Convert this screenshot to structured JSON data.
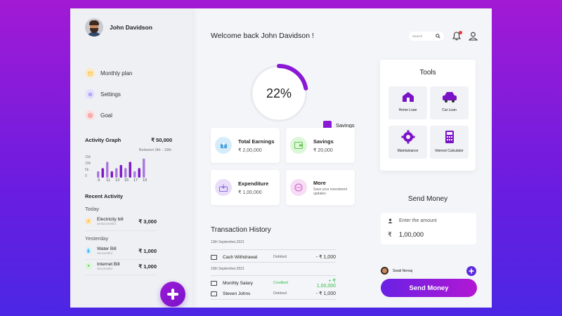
{
  "profile": {
    "name": "John Davidson"
  },
  "menu": [
    {
      "label": "Monthly plan",
      "color": "#f5c542",
      "bg": "#fbe9c7",
      "icon": "calendar-icon"
    },
    {
      "label": "Settings",
      "color": "#8f86e8",
      "bg": "#e3e1fb",
      "icon": "gear-icon"
    },
    {
      "label": "Goal",
      "color": "#ef6f6f",
      "bg": "#fbdfdf",
      "icon": "target-icon"
    }
  ],
  "activity": {
    "title": "Activity Graph",
    "amount": "₹ 50,000",
    "range": "Between  9th - 19th"
  },
  "chart_data": {
    "type": "bar",
    "title": "Activity Graph",
    "categories": [
      "9",
      "10",
      "11",
      "12",
      "13",
      "14",
      "15",
      "16",
      "17",
      "18",
      "19"
    ],
    "values": [
      4,
      6,
      10,
      4,
      6,
      8,
      6,
      10,
      4,
      6,
      12
    ],
    "y_ticks": [
      "15k",
      "10k",
      "5k",
      "0"
    ],
    "x_tick_labels": [
      "9",
      "11",
      "13",
      "15",
      "17",
      "19"
    ],
    "ylim": [
      0,
      15
    ],
    "colors": [
      "#a978dd",
      "#7d12c6"
    ]
  },
  "recent": {
    "title": "Recent Activity",
    "today_label": "Today",
    "yesterday_label": "Yesterday",
    "today": [
      {
        "name": "Electricity bill",
        "status": "Unsuccessful",
        "amount": "₹ 3,000",
        "color": "#f7b267",
        "icon": "bolt-icon"
      }
    ],
    "yesterday": [
      {
        "name": "Water Bill",
        "status": "Successful",
        "amount": "₹ 1,000",
        "color": "#7fc4f0",
        "icon": "drop-icon"
      },
      {
        "name": "Internet Bill",
        "status": "Successful",
        "amount": "₹ 1,000",
        "color": "#8ee08e",
        "icon": "wifi-icon"
      }
    ]
  },
  "header": {
    "welcome": "Welcome back John Davidson !",
    "search_placeholder": "Search"
  },
  "savings": {
    "percent": "22%",
    "fraction": 0.22,
    "legend": "Savings",
    "color": "#8a18d4"
  },
  "cards": [
    {
      "title": "Total Earnings",
      "value": "₹ 2,00,000",
      "icon": "upload-icon",
      "bg": "#d6ecfb",
      "fg": "#4aa3e0"
    },
    {
      "title": "Savings",
      "value": "₹ 20,000",
      "icon": "wallet-icon",
      "bg": "#dcf6d8",
      "fg": "#6cc35a"
    },
    {
      "title": "Expenditure",
      "value": "₹ 1,00,000",
      "icon": "inbox-icon",
      "bg": "#e8defa",
      "fg": "#8f6fd8"
    },
    {
      "title": "More",
      "value": "Save your investment updates",
      "icon": "more-icon",
      "bg": "#f7dcf5",
      "fg": "#cf5cc9"
    }
  ],
  "transactions": {
    "title": "Transaction History",
    "groups": [
      {
        "date": "13th September,2021",
        "items": [
          {
            "name": "Cash Withdrawal",
            "status": "Debited",
            "amount": "- ₹ 1,000",
            "status_color": "#666",
            "amount_color": "#333"
          }
        ]
      },
      {
        "date": "10th September,2021",
        "items": [
          {
            "name": "Monthly Salary",
            "status": "Credited",
            "amount": "+ ₹ 1,00,000",
            "status_color": "#2fbf4a",
            "amount_color": "#2fbf4a"
          },
          {
            "name": "Steven Johns",
            "status": "Debited",
            "amount": "- ₹ 1,000",
            "status_color": "#666",
            "amount_color": "#333"
          }
        ]
      }
    ]
  },
  "tools": {
    "title": "Tools",
    "items": [
      {
        "label": "Home Loan",
        "icon": "home-loan-icon"
      },
      {
        "label": "Car Loan",
        "icon": "car-loan-icon"
      },
      {
        "label": "Maintainance",
        "icon": "gear-icon"
      },
      {
        "label": "Interest Calculator",
        "icon": "calculator-icon"
      }
    ],
    "accent": "#7a12c7"
  },
  "send": {
    "title": "Send Money",
    "hint": "Enter the amount",
    "currency": "₹",
    "amount": "1,00,000",
    "recipient": "Swati Nerxaj",
    "button": "Send Money"
  }
}
